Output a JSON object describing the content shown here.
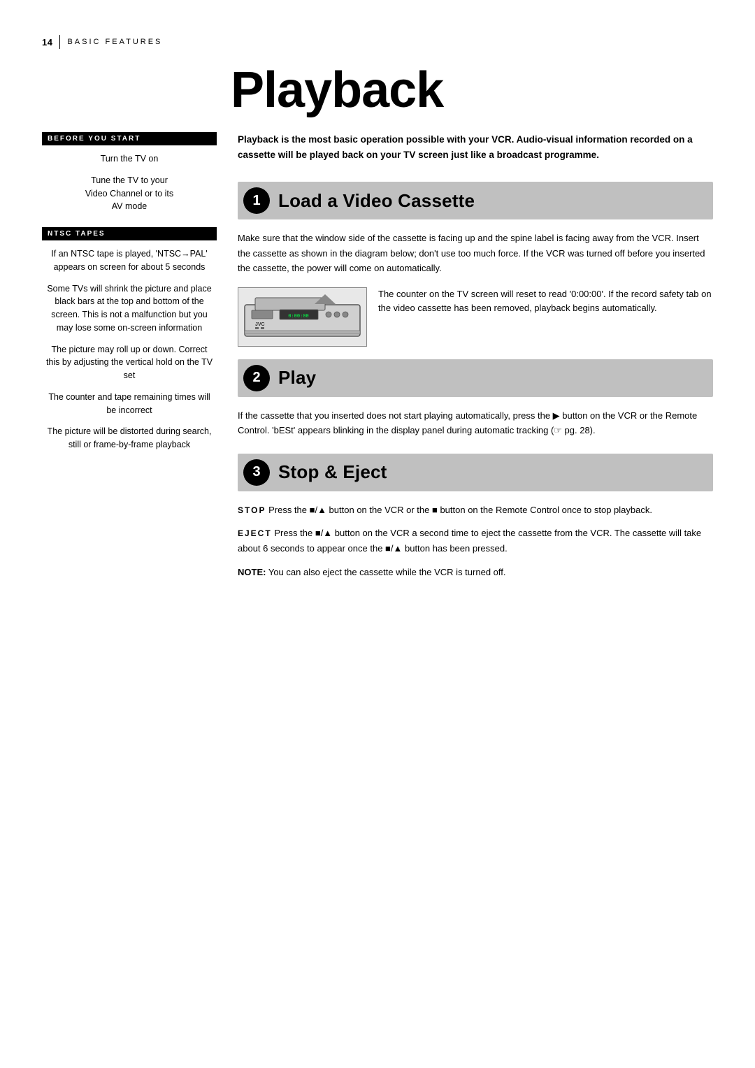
{
  "header": {
    "page_number": "14",
    "divider": "|",
    "section": "BASIC FEATURES"
  },
  "title": "Playback",
  "intro": "Playback is the most basic operation possible with your VCR. Audio-visual information recorded on a cassette will be played back on your TV screen just like a broadcast programme.",
  "step1": {
    "number": "1",
    "title": "Load a Video Cassette",
    "before_you_start_label": "BEFORE YOU START",
    "sidebar_items": [
      "Turn the TV on",
      "Tune the TV to your Video Channel or to its AV mode"
    ],
    "ntsc_label": "NTSC TAPES",
    "ntsc_items": [
      "If an NTSC tape is played, 'NTSC→PAL' appears on screen for about 5 seconds",
      "Some TVs will shrink the picture and place black bars at the top and bottom of the screen. This is not a malfunction but you may lose some on-screen information",
      "The picture may roll up or down. Correct this by adjusting the vertical hold on the TV set",
      "The counter and tape remaining times will be incorrect",
      "The picture will be distorted during search, still or frame-by-frame playback"
    ],
    "main_text": "Make sure that the window side of the cassette is facing up and the spine label is facing away from the VCR. Insert the cassette as shown in the diagram below; don't use too much force. If the VCR was turned off before you inserted the cassette, the power will come on automatically.",
    "counter_text": "The counter on the TV screen will reset to read '0:00:00'. If the record safety tab on the video cassette has been removed, playback begins automatically."
  },
  "step2": {
    "number": "2",
    "title": "Play",
    "main_text": "If the cassette that you inserted does not start playing automatically, press the ▶ button on the VCR or the Remote Control. 'bESt' appears blinking in the display panel during automatic tracking (☞ pg. 28)."
  },
  "step3": {
    "number": "3",
    "title": "Stop & Eject",
    "stop_label": "STOP",
    "stop_text": "Press the ■/▲ button on the VCR or the ■ button on the Remote Control once to stop playback.",
    "eject_label": "EJECT",
    "eject_text": "Press the ■/▲ button on the VCR a second time to eject the cassette from the VCR. The cassette will take about 6 seconds to appear once the ■/▲ button has been pressed.",
    "note_label": "NOTE:",
    "note_text": "You can also eject the cassette while the VCR is turned off."
  }
}
